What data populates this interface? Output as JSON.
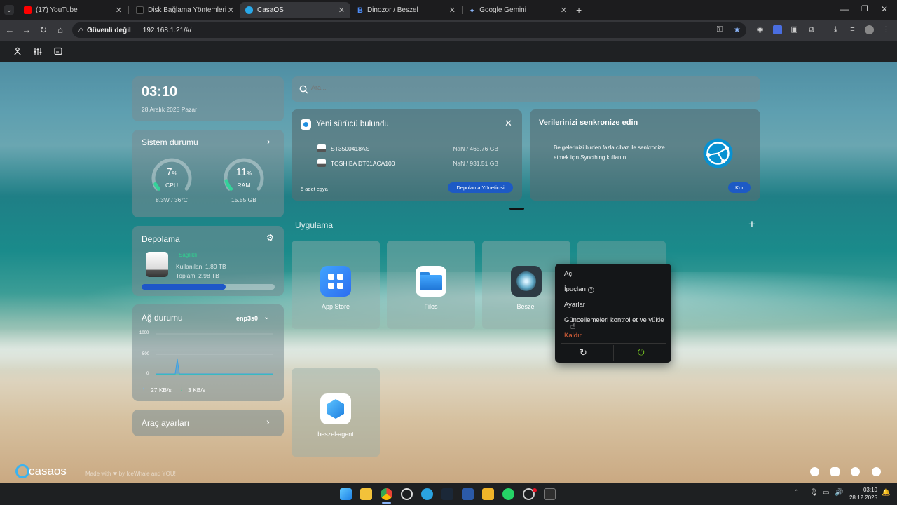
{
  "browser": {
    "tabs": [
      {
        "title": "(17) YouTube",
        "favicon_color": "#ff0000"
      },
      {
        "title": "Disk Bağlama Yöntemleri",
        "favicon_color": "#111111"
      },
      {
        "title": "CasaOS",
        "favicon_color": "#29a8e8"
      },
      {
        "title": "Dinozor / Beszel",
        "favicon_color": "#4c8bf5"
      },
      {
        "title": "Google Gemini",
        "favicon_color": "#8ab4f8"
      }
    ],
    "active_tab": 2,
    "security_label": "Güvenli değil",
    "url": "192.168.1.21/#/"
  },
  "clock": {
    "time": "03:10",
    "date": "28 Aralık 2025 Pazar"
  },
  "search": {
    "placeholder": "Ara..."
  },
  "system": {
    "title": "Sistem durumu",
    "cpu": {
      "value": "7",
      "unit": "%",
      "label": "CPU",
      "detail": "8.3W / 36°C",
      "percent": 7
    },
    "ram": {
      "value": "11",
      "unit": "%",
      "label": "RAM",
      "detail": "15.55 GB",
      "percent": 11
    }
  },
  "storage": {
    "title": "Depolama",
    "health": "Sağlıklı",
    "used": "Kullanılan: 1.89 TB",
    "total": "Toplam: 2.98 TB",
    "fill_fraction": 0.63
  },
  "network": {
    "title": "Ağ durumu",
    "interface": "enp3s0",
    "axis": [
      "1000",
      "500",
      "0"
    ],
    "upload": "27 KB/s",
    "download": "3 KB/s"
  },
  "tools": {
    "title": "Araç ayarları"
  },
  "drive_notice": {
    "title": "Yeni sürücü bulundu",
    "drives": [
      {
        "name": "ST3500418AS",
        "size": "NaN / 465.76 GB"
      },
      {
        "name": "TOSHIBA DT01ACA100",
        "size": "NaN / 931.51 GB"
      }
    ],
    "count": "5 adet eşya",
    "button": "Depolama Yöneticisi"
  },
  "sync": {
    "title": "Verilerinizi senkronize edin",
    "body_line1": "Belgelerinizi birden fazla cihaz ile senkronize",
    "body_line2": "etmek için Syncthing kullanın",
    "button": "Kur"
  },
  "apps": {
    "section_title": "Uygulama",
    "items": [
      {
        "label": "App Store"
      },
      {
        "label": "Files"
      },
      {
        "label": "Beszel"
      },
      {
        "label": "beszel-agent"
      }
    ]
  },
  "context_menu": {
    "items": [
      "Aç",
      "İpuçları",
      "Ayarlar",
      "Güncellemeleri kontrol et ve yükle",
      "Kaldır"
    ]
  },
  "footer": {
    "brand": "casaos",
    "credit": "Made with ❤ by IceWhale and YOU!"
  },
  "taskbar": {
    "time": "03:10",
    "date": "28.12.2025"
  }
}
